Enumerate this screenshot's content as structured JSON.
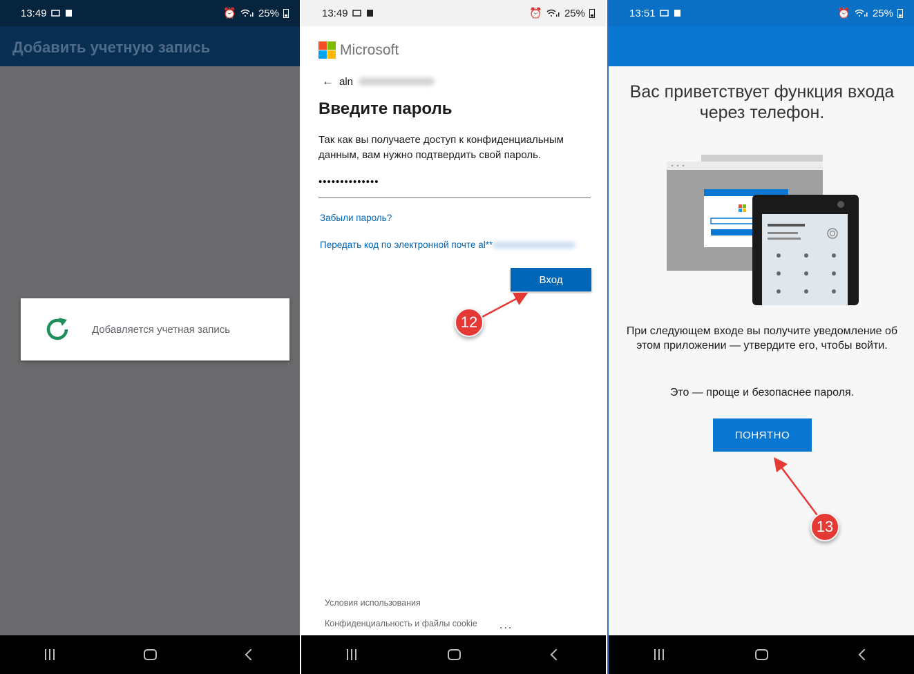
{
  "panels": [
    {
      "status": {
        "time": "13:49",
        "battery": "25%"
      },
      "appbar_title": "Добавить учетную запись",
      "dialog_text": "Добавляется учетная запись"
    },
    {
      "status": {
        "time": "13:49",
        "battery": "25%"
      },
      "brand": "Microsoft",
      "account_prefix": "aln",
      "title": "Введите пароль",
      "description": "Так как вы получаете доступ к конфиденциальным данным, вам нужно подтвердить свой пароль.",
      "password_value": "••••••••••••••",
      "forgot_link": "Забыли пароль?",
      "email_code_link": "Передать код по электронной почте al**",
      "login_button": "Вход",
      "callout": "12",
      "footer_terms": "Условия использования",
      "footer_privacy": "Конфиденциальность и файлы cookie",
      "footer_more": "..."
    },
    {
      "status": {
        "time": "13:51",
        "battery": "25%"
      },
      "title": "Вас приветствует функция входа через телефон.",
      "text": "При следующем входе вы получите уведомление об этом приложении — утвердите его, чтобы войти.",
      "text2": "Это — проще и безопаснее пароля.",
      "ok_button": "ПОНЯТНО",
      "callout": "13"
    }
  ],
  "colors": {
    "ms_red": "#f25022",
    "ms_green": "#7fba00",
    "ms_blue": "#00a4ef",
    "ms_yellow": "#ffb900",
    "accent_blue": "#0067b8",
    "header_blue": "#0a78d2",
    "callout_red": "#e53935",
    "spinner_green": "#1e8e5a"
  }
}
